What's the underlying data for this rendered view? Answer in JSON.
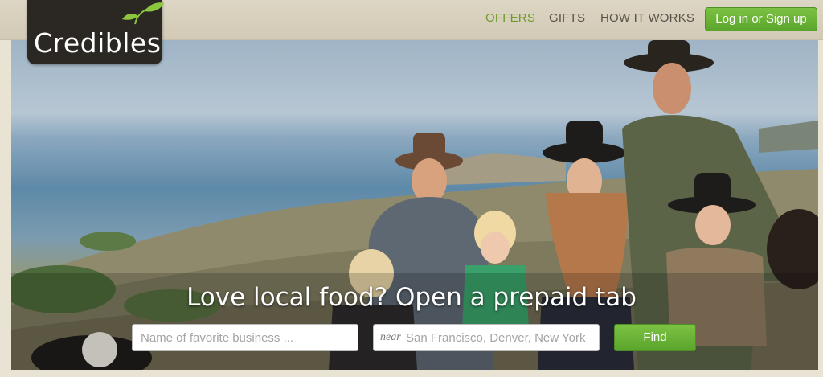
{
  "brand": {
    "name": "Credibles"
  },
  "nav": {
    "offers": "OFFERS",
    "gifts": "GIFTS",
    "how_it_works": "HOW IT WORKS",
    "login": "Log in or Sign up"
  },
  "hero": {
    "tagline": "Love local food? Open a prepaid tab"
  },
  "search": {
    "business_placeholder": "Name of favorite business ...",
    "near_label": "near",
    "location_placeholder": "San Francisco, Denver, New York",
    "find_label": "Find"
  },
  "colors": {
    "accent_green": "#5aa52c",
    "nav_active": "#6e9a2e",
    "logo_bg": "#2b2824"
  },
  "icons": {
    "logo_leaves": "sprout-icon"
  }
}
